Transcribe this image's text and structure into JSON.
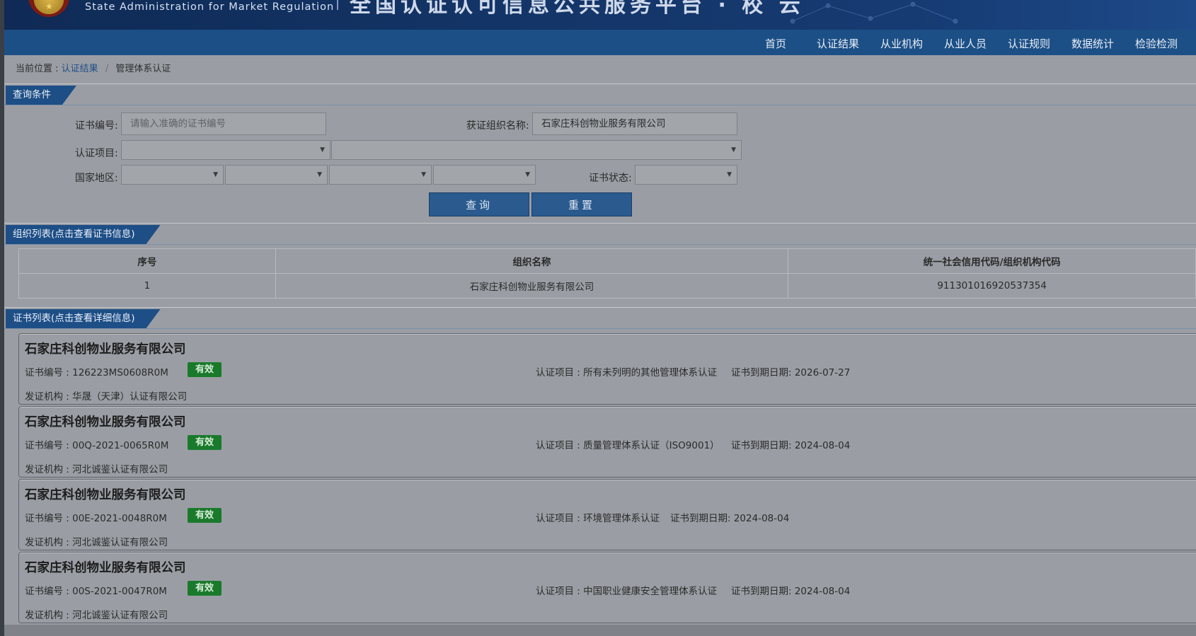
{
  "header": {
    "agency_en": "State Administration  for  Market Regulation",
    "site_title": "全国认证认可信息公共服务平台 · 校 云"
  },
  "nav": [
    "首页",
    "认证结果",
    "从业机构",
    "从业人员",
    "认证规则",
    "数据统计",
    "检验检测"
  ],
  "breadcrumb": {
    "prefix": "当前位置 :",
    "link": "认证结果",
    "sep": "/",
    "current": "管理体系认证"
  },
  "query": {
    "title": "查询条件",
    "cert_no_label": "证书编号:",
    "cert_no_placeholder": "请输入准确的证书编号",
    "org_label": "获证组织名称:",
    "org_value": "石家庄科创物业服务有限公司",
    "project_label": "认证项目:",
    "region_label": "国家地区:",
    "status_label": "证书状态:",
    "search_label": "查询",
    "reset_label": "重置"
  },
  "org_list": {
    "title": "组织列表(点击查看证书信息)",
    "headers": [
      "序号",
      "组织名称",
      "统一社会信用代码/组织机构代码"
    ],
    "rows": [
      [
        "1",
        "石家庄科创物业服务有限公司",
        "911301016920537354"
      ]
    ]
  },
  "cert_list": {
    "title": "证书列表(点击查看详细信息)",
    "items": [
      {
        "org": "石家庄科创物业服务有限公司",
        "cert_no": "证书编号 : 126223MS0608R0M",
        "status": "有效",
        "project": "认证项目 : 所有未列明的其他管理体系认证",
        "expiry": "证书到期日期: 2026-07-27",
        "issuer": "发证机构 : 华晟（天津）认证有限公司"
      },
      {
        "org": "石家庄科创物业服务有限公司",
        "cert_no": "证书编号 : 00Q-2021-0065R0M",
        "status": "有效",
        "project": "认证项目 : 质量管理体系认证（ISO9001）",
        "expiry": "证书到期日期: 2024-08-04",
        "issuer": "发证机构 : 河北诚鉴认证有限公司"
      },
      {
        "org": "石家庄科创物业服务有限公司",
        "cert_no": "证书编号 : 00E-2021-0048R0M",
        "status": "有效",
        "project": "认证项目 : 环境管理体系认证",
        "expiry": "证书到期日期: 2024-08-04",
        "issuer": "发证机构 : 河北诚鉴认证有限公司"
      },
      {
        "org": "石家庄科创物业服务有限公司",
        "cert_no": "证书编号 : 00S-2021-0047R0M",
        "status": "有效",
        "project": "认证项目 : 中国职业健康安全管理体系认证",
        "expiry": "证书到期日期: 2024-08-04",
        "issuer": "发证机构 : 河北诚鉴认证有限公司"
      }
    ]
  },
  "colors": {
    "header_bg": "#133466",
    "nav_bg": "#1c4f86",
    "badge_green": "#1a7a2c",
    "button_blue": "#2a5a8e"
  },
  "icons": {
    "emblem": "national-emblem-icon",
    "caret": "chevron-down-icon"
  }
}
